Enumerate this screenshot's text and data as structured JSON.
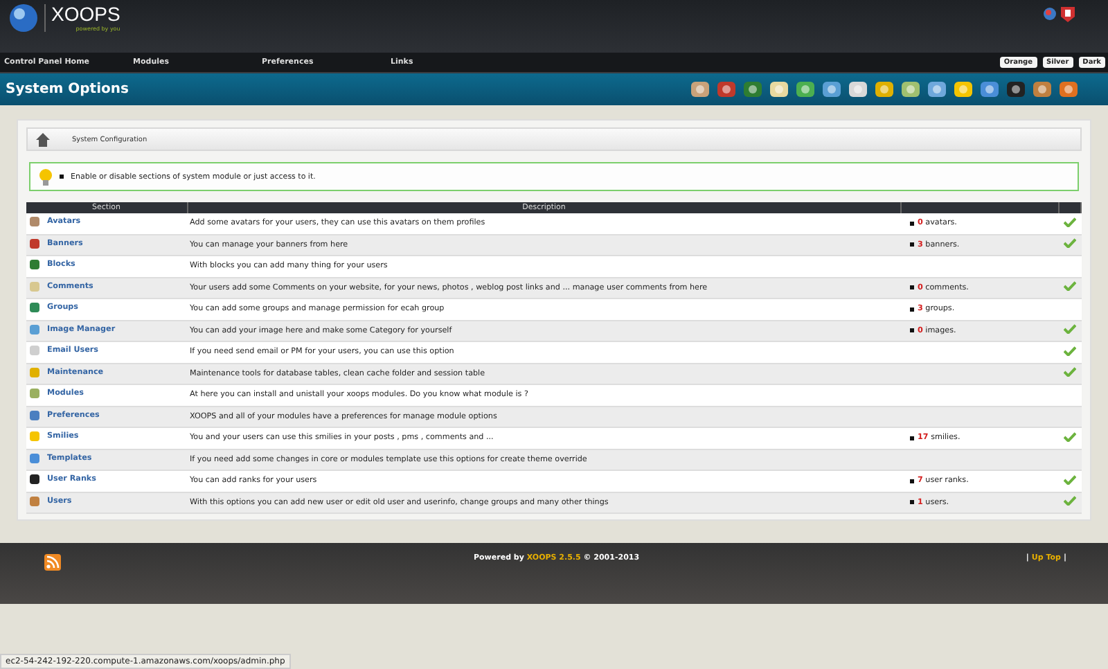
{
  "header": {
    "logo": "XOOPS",
    "tagline": "powered by you"
  },
  "menu": [
    "Control Panel Home",
    "Modules",
    "Preferences",
    "Links"
  ],
  "themes": [
    "Orange",
    "Silver",
    "Dark"
  ],
  "page_title": "System Options",
  "breadcrumb": "System Configuration",
  "tip": "Enable or disable sections of system module or just access to it.",
  "table": {
    "columns": [
      "Section",
      "Description"
    ],
    "rows": [
      {
        "name": "Avatars",
        "description": "Add some avatars for your users, they can use this avatars on them profiles",
        "count": "0",
        "count_label": "avatars.",
        "active": true
      },
      {
        "name": "Banners",
        "description": "You can manage your banners from here",
        "count": "3",
        "count_label": "banners.",
        "active": true
      },
      {
        "name": "Blocks",
        "description": "With blocks you can add many thing for your users",
        "active": false
      },
      {
        "name": "Comments",
        "description": "Your users add some Comments on your website, for your news, photos , weblog post links and ... manage user comments from here",
        "count": "0",
        "count_label": "comments.",
        "active": true
      },
      {
        "name": "Groups",
        "description": "You can add some groups and manage permission for ecah group",
        "count": "3",
        "count_label": "groups.",
        "active": false
      },
      {
        "name": "Image Manager",
        "description": "You can add your image here and make some Category for yourself",
        "count": "0",
        "count_label": "images.",
        "active": true
      },
      {
        "name": "Email Users",
        "description": "If you need send email or PM for your users, you can use this option",
        "active": true
      },
      {
        "name": "Maintenance",
        "description": "Maintenance tools for database tables, clean cache folder and session table",
        "active": true
      },
      {
        "name": "Modules",
        "description": "At here you can install and unistall your xoops modules. Do you know what module is ?",
        "active": false
      },
      {
        "name": "Preferences",
        "description": "XOOPS and all of your modules have a preferences for manage module options",
        "active": false
      },
      {
        "name": "Smilies",
        "description": "You and your users can use this smilies in your posts , pms , comments and ...",
        "count": "17",
        "count_label": "smilies.",
        "active": true
      },
      {
        "name": "Templates",
        "description": "If you need add some changes in core or modules template use this options for create theme override",
        "active": false
      },
      {
        "name": "User Ranks",
        "description": "You can add ranks for your users",
        "count": "7",
        "count_label": "user ranks.",
        "active": true
      },
      {
        "name": "Users",
        "description": "With this options you can add new user or edit old user and userinfo, change groups and many other things",
        "count": "1",
        "count_label": "users.",
        "active": true
      }
    ]
  },
  "footer": {
    "powered_by": "Powered by",
    "product": "XOOPS 2.5.5",
    "copyright": "© 2001-2013",
    "up_top_left": "|",
    "up_top": "Up Top",
    "up_top_right": "|"
  },
  "status_bar": "ec2-54-242-192-220.compute-1.amazonaws.com/xoops/admin.php"
}
